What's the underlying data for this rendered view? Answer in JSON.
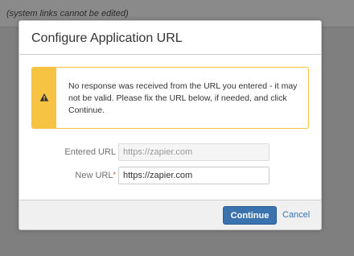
{
  "background": {
    "note": "(system links cannot be edited)"
  },
  "dialog": {
    "title": "Configure Application URL",
    "warning": {
      "icon": "warning-icon",
      "message": "No response was received from the URL you entered - it may not be valid. Please fix the URL below, if needed, and click Continue."
    },
    "fields": {
      "entered_url_label": "Entered URL",
      "entered_url_value": "https://zapier.com",
      "new_url_label": "New URL",
      "new_url_required": "*",
      "new_url_value": "https://zapier.com"
    },
    "buttons": {
      "continue": "Continue",
      "cancel": "Cancel"
    }
  },
  "colors": {
    "warning": "#f6c342",
    "primary": "#3b73af",
    "required": "#d04437"
  }
}
